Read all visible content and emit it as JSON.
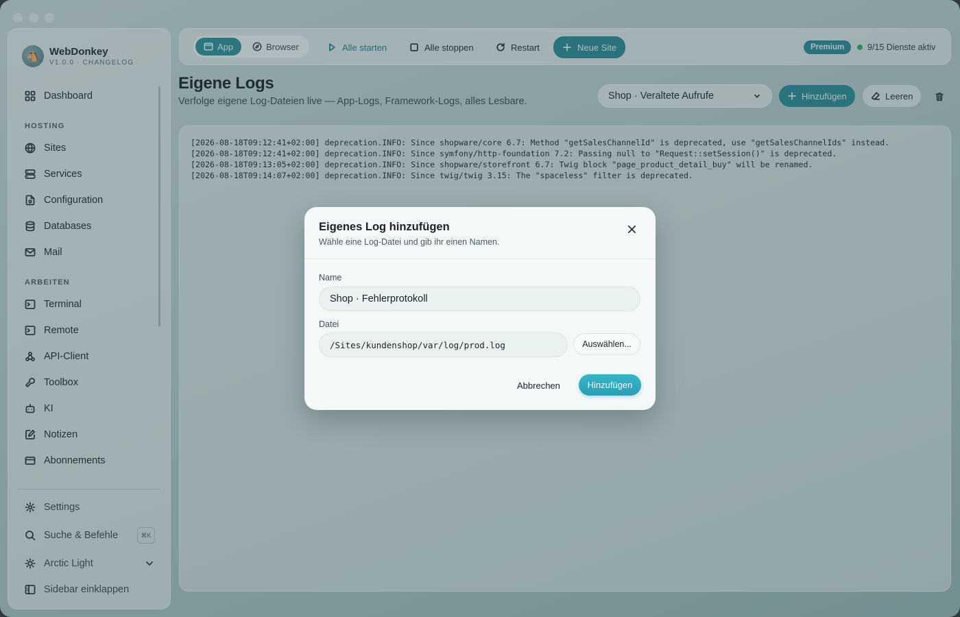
{
  "app": {
    "name": "WebDonkey",
    "version": "V1.0.0 · CHANGELOG"
  },
  "sidebar": {
    "dashboard": "Dashboard",
    "section_hosting": "HOSTING",
    "hosting": [
      "Sites",
      "Services",
      "Configuration",
      "Databases",
      "Mail"
    ],
    "section_work": "ARBEITEN",
    "work": [
      "Terminal",
      "Remote",
      "API-Client",
      "Toolbox",
      "KI",
      "Notizen",
      "Abonnements"
    ],
    "settings": "Settings",
    "search": "Suche & Befehle",
    "search_shortcut": "⌘K",
    "theme": "Arctic Light",
    "collapse": "Sidebar einklappen"
  },
  "toolbar": {
    "mode_app": "App",
    "mode_browser": "Browser",
    "start_all": "Alle starten",
    "stop_all": "Alle stoppen",
    "restart": "Restart",
    "new_site": "Neue Site",
    "premium": "Premium",
    "services_status": "9/15 Dienste aktiv"
  },
  "page": {
    "title": "Eigene Logs",
    "subtitle": "Verfolge eigene Log-Dateien live — App-Logs, Framework-Logs, alles Lesbare.",
    "selected_log": "Shop · Veraltete Aufrufe",
    "add": "Hinzufügen",
    "clear": "Leeren"
  },
  "logs": [
    "[2026-08-18T09:12:41+02:00] deprecation.INFO: Since shopware/core 6.7: Method \"getSalesChannelId\" is deprecated, use \"getSalesChannelIds\" instead.",
    "[2026-08-18T09:12:41+02:00] deprecation.INFO: Since symfony/http-foundation 7.2: Passing null to \"Request::setSession()\" is deprecated.",
    "[2026-08-18T09:13:05+02:00] deprecation.INFO: Since shopware/storefront 6.7: Twig block \"page_product_detail_buy\" will be renamed.",
    "[2026-08-18T09:14:07+02:00] deprecation.INFO: Since twig/twig 3.15: The \"spaceless\" filter is deprecated."
  ],
  "modal": {
    "title": "Eigenes Log hinzufügen",
    "subtitle": "Wähle eine Log-Datei und gib ihr einen Namen.",
    "name_label": "Name",
    "name_value": "Shop · Fehlerprotokoll",
    "file_label": "Datei",
    "file_value": "/Sites/kundenshop/var/log/prod.log",
    "choose": "Auswählen...",
    "cancel": "Abbrechen",
    "submit": "Hinzufügen"
  },
  "colors": {
    "accent": "#2b8b96",
    "status_active": "#2fb06a",
    "submit": "#2a9fb5"
  }
}
